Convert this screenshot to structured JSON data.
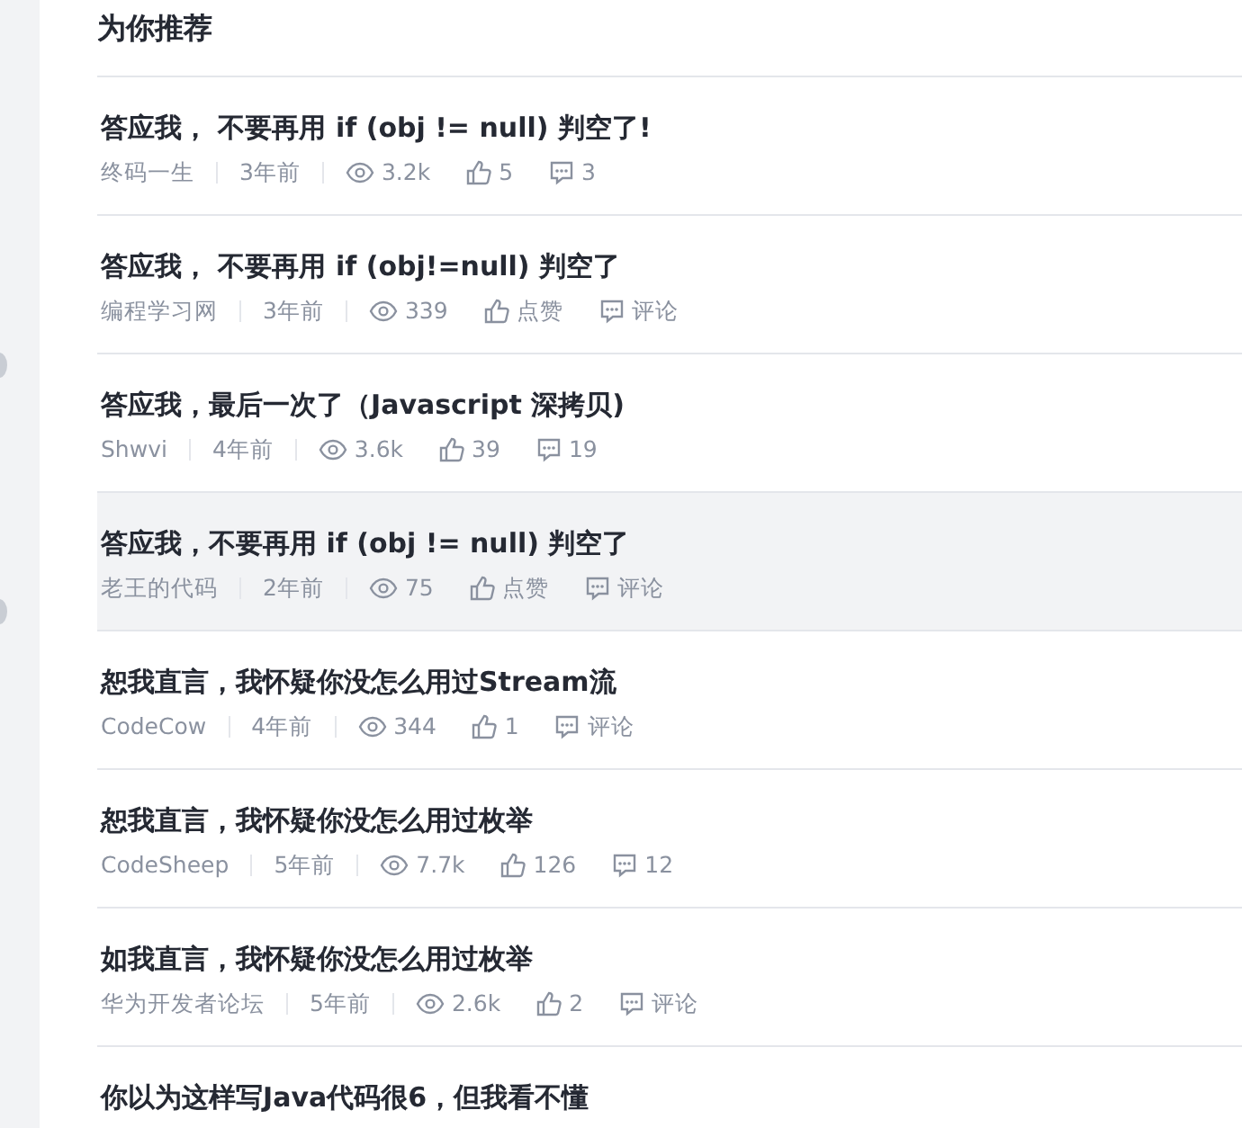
{
  "section_title": "为你推荐",
  "articles": [
    {
      "title": "答应我， 不要再用 if (obj != null) 判空了!",
      "author": "终码一生",
      "time": "3年前",
      "views": "3.2k",
      "likes": "5",
      "comments": "3",
      "hovered": false
    },
    {
      "title": "答应我， 不要再用 if (obj!=null) 判空了",
      "author": "编程学习网",
      "time": "3年前",
      "views": "339",
      "likes": "点赞",
      "comments": "评论",
      "hovered": false
    },
    {
      "title": "答应我，最后一次了（Javascript 深拷贝)",
      "author": "Shwvi",
      "time": "4年前",
      "views": "3.6k",
      "likes": "39",
      "comments": "19",
      "hovered": false
    },
    {
      "title": "答应我，不要再用 if (obj != null) 判空了",
      "author": "老王的代码",
      "time": "2年前",
      "views": "75",
      "likes": "点赞",
      "comments": "评论",
      "hovered": true
    },
    {
      "title": "恕我直言，我怀疑你没怎么用过Stream流",
      "author": "CodeCow",
      "time": "4年前",
      "views": "344",
      "likes": "1",
      "comments": "评论",
      "hovered": false
    },
    {
      "title": "恕我直言，我怀疑你没怎么用过枚举",
      "author": "CodeSheep",
      "time": "5年前",
      "views": "7.7k",
      "likes": "126",
      "comments": "12",
      "hovered": false
    },
    {
      "title": "如我直言，我怀疑你没怎么用过枚举",
      "author": "华为开发者论坛",
      "time": "5年前",
      "views": "2.6k",
      "likes": "2",
      "comments": "评论",
      "hovered": false
    },
    {
      "title": "你以为这样写Java代码很6，但我看不懂",
      "hovered": false
    }
  ]
}
